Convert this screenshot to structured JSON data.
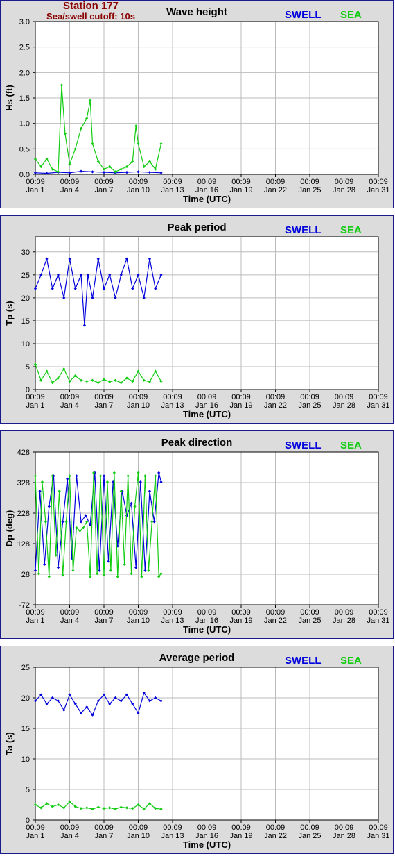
{
  "header": {
    "station": "Station 177",
    "cutoff": "Sea/swell cutoff: 10s"
  },
  "legend": {
    "swell": "SWELL",
    "sea": "SEA"
  },
  "colors": {
    "swell": "#0000dd",
    "sea": "#11cc11",
    "title": "#000000",
    "station": "#8b0000",
    "grid": "#bbbbbb",
    "panel_bg": "#dcdcdc",
    "plot_bg": "#ffffff",
    "border": "#1a1a8c"
  },
  "x_axis": {
    "label": "Time (UTC)",
    "tick_times": [
      "00:09",
      "00:09",
      "00:09",
      "00:09",
      "00:09",
      "00:09",
      "00:09",
      "00:09",
      "00:09",
      "00:09",
      "00:09"
    ],
    "tick_dates": [
      "Jan 1",
      "Jan 4",
      "Jan 7",
      "Jan 10",
      "Jan 13",
      "Jan 16",
      "Jan 19",
      "Jan 22",
      "Jan 25",
      "Jan 28",
      "Jan 31"
    ]
  },
  "chart_data": [
    {
      "type": "line",
      "title": "Wave height",
      "ylabel": "Hs (ft)",
      "ylim": [
        0,
        3
      ],
      "yticks": [
        "0.0",
        "0.5",
        "1.0",
        "1.5",
        "2.0",
        "2.5",
        "3.0"
      ],
      "xlim": [
        "Jan 1",
        "Jan 31"
      ],
      "series": [
        {
          "name": "SWELL",
          "x": [
            "Jan 1",
            "Jan 2",
            "Jan 3",
            "Jan 4",
            "Jan 5",
            "Jan 6",
            "Jan 7",
            "Jan 8",
            "Jan 9",
            "Jan 10",
            "Jan 11",
            "Jan 12"
          ],
          "values": [
            0.03,
            0.02,
            0.04,
            0.03,
            0.06,
            0.05,
            0.04,
            0.03,
            0.04,
            0.05,
            0.04,
            0.03
          ]
        },
        {
          "name": "SEA",
          "x": [
            "Jan 1",
            "Jan 1.5",
            "Jan 2",
            "Jan 2.5",
            "Jan 3",
            "Jan 3.3",
            "Jan 3.6",
            "Jan 4",
            "Jan 4.5",
            "Jan 5",
            "Jan 5.5",
            "Jan 5.8",
            "Jan 6",
            "Jan 6.5",
            "Jan 7",
            "Jan 7.5",
            "Jan 8",
            "Jan 8.5",
            "Jan 9",
            "Jan 9.5",
            "Jan 9.8",
            "Jan 10",
            "Jan 10.5",
            "Jan 11",
            "Jan 11.5",
            "Jan 12"
          ],
          "values": [
            0.3,
            0.15,
            0.3,
            0.1,
            0.05,
            1.75,
            0.8,
            0.2,
            0.5,
            0.9,
            1.1,
            1.45,
            0.6,
            0.25,
            0.1,
            0.15,
            0.05,
            0.1,
            0.15,
            0.25,
            0.95,
            0.6,
            0.15,
            0.25,
            0.1,
            0.6
          ]
        }
      ]
    },
    {
      "type": "line",
      "title": "Peak period",
      "ylabel": "Tp (s)",
      "ylim": [
        0,
        33.3
      ],
      "yticks": [
        "0",
        "5",
        "10",
        "15",
        "20",
        "25",
        "30"
      ],
      "xlim": [
        "Jan 1",
        "Jan 31"
      ],
      "series": [
        {
          "name": "SWELL",
          "x": [
            "Jan 1",
            "Jan 1.5",
            "Jan 2",
            "Jan 2.5",
            "Jan 3",
            "Jan 3.5",
            "Jan 4",
            "Jan 4.5",
            "Jan 5",
            "Jan 5.3",
            "Jan 5.6",
            "Jan 6",
            "Jan 6.5",
            "Jan 7",
            "Jan 7.5",
            "Jan 8",
            "Jan 8.5",
            "Jan 9",
            "Jan 9.5",
            "Jan 10",
            "Jan 10.5",
            "Jan 11",
            "Jan 11.5",
            "Jan 12"
          ],
          "values": [
            22,
            25,
            28.5,
            22,
            25,
            20,
            28.5,
            22,
            25,
            14,
            25,
            20,
            28.5,
            22,
            25,
            20,
            25,
            28.5,
            22,
            25,
            20,
            28.5,
            22,
            25
          ]
        },
        {
          "name": "SEA",
          "x": [
            "Jan 1",
            "Jan 1.5",
            "Jan 2",
            "Jan 2.5",
            "Jan 3",
            "Jan 3.5",
            "Jan 4",
            "Jan 4.5",
            "Jan 5",
            "Jan 5.5",
            "Jan 6",
            "Jan 6.5",
            "Jan 7",
            "Jan 7.5",
            "Jan 8",
            "Jan 8.5",
            "Jan 9",
            "Jan 9.5",
            "Jan 10",
            "Jan 10.5",
            "Jan 11",
            "Jan 11.5",
            "Jan 12"
          ],
          "values": [
            5.5,
            2,
            4,
            1.5,
            2.5,
            4.5,
            1.8,
            3,
            2,
            1.8,
            2,
            1.5,
            2.2,
            1.7,
            2,
            1.5,
            2.5,
            1.8,
            4,
            2,
            1.7,
            4,
            1.8
          ]
        }
      ]
    },
    {
      "type": "line",
      "title": "Peak direction",
      "ylabel": "Dp (deg)",
      "ylim": [
        -72,
        428
      ],
      "yticks": [
        "-72",
        "28",
        "128",
        "228",
        "328",
        "428"
      ],
      "xlim": [
        "Jan 1",
        "Jan 31"
      ],
      "series": [
        {
          "name": "SWELL",
          "x": [
            "Jan 1",
            "Jan 1.4",
            "Jan 1.8",
            "Jan 2.2",
            "Jan 2.6",
            "Jan 3",
            "Jan 3.4",
            "Jan 3.8",
            "Jan 4.2",
            "Jan 4.6",
            "Jan 5",
            "Jan 5.4",
            "Jan 5.8",
            "Jan 6.2",
            "Jan 6.6",
            "Jan 7",
            "Jan 7.4",
            "Jan 7.8",
            "Jan 8.2",
            "Jan 8.6",
            "Jan 9",
            "Jan 9.4",
            "Jan 9.8",
            "Jan 10.2",
            "Jan 10.6",
            "Jan 11",
            "Jan 11.4",
            "Jan 11.8",
            "Jan 12"
          ],
          "values": [
            40,
            300,
            60,
            250,
            350,
            50,
            200,
            340,
            80,
            350,
            200,
            220,
            190,
            360,
            40,
            350,
            70,
            330,
            120,
            300,
            220,
            260,
            50,
            330,
            40,
            300,
            200,
            360,
            330
          ]
        },
        {
          "name": "SEA",
          "x": [
            "Jan 1",
            "Jan 1.3",
            "Jan 1.6",
            "Jan 1.9",
            "Jan 2.2",
            "Jan 2.5",
            "Jan 2.8",
            "Jan 3.1",
            "Jan 3.4",
            "Jan 3.7",
            "Jan 4",
            "Jan 4.3",
            "Jan 4.6",
            "Jan 4.9",
            "Jan 5.2",
            "Jan 5.5",
            "Jan 5.8",
            "Jan 6.1",
            "Jan 6.4",
            "Jan 6.7",
            "Jan 7",
            "Jan 7.3",
            "Jan 7.6",
            "Jan 7.9",
            "Jan 8.2",
            "Jan 8.5",
            "Jan 8.8",
            "Jan 9.1",
            "Jan 9.4",
            "Jan 9.7",
            "Jan 10",
            "Jan 10.3",
            "Jan 10.6",
            "Jan 10.9",
            "Jan 11.2",
            "Jan 11.5",
            "Jan 11.8",
            "Jan 12"
          ],
          "values": [
            350,
            30,
            330,
            200,
            20,
            350,
            90,
            300,
            25,
            200,
            350,
            40,
            180,
            170,
            180,
            200,
            20,
            360,
            30,
            350,
            25,
            330,
            40,
            360,
            20,
            300,
            60,
            350,
            30,
            250,
            360,
            20,
            350,
            40,
            200,
            350,
            20,
            30
          ]
        }
      ]
    },
    {
      "type": "line",
      "title": "Average period",
      "ylabel": "Ta (s)",
      "ylim": [
        0,
        25
      ],
      "yticks": [
        "0",
        "5",
        "10",
        "15",
        "20",
        "25"
      ],
      "xlim": [
        "Jan 1",
        "Jan 31"
      ],
      "series": [
        {
          "name": "SWELL",
          "x": [
            "Jan 1",
            "Jan 1.5",
            "Jan 2",
            "Jan 2.5",
            "Jan 3",
            "Jan 3.5",
            "Jan 4",
            "Jan 4.5",
            "Jan 5",
            "Jan 5.5",
            "Jan 6",
            "Jan 6.5",
            "Jan 7",
            "Jan 7.5",
            "Jan 8",
            "Jan 8.5",
            "Jan 9",
            "Jan 9.5",
            "Jan 10",
            "Jan 10.5",
            "Jan 11",
            "Jan 11.5",
            "Jan 12"
          ],
          "values": [
            19.5,
            20.5,
            19,
            20,
            19.5,
            18,
            20.5,
            19,
            17.5,
            18.5,
            17.2,
            19.5,
            20.5,
            19,
            20,
            19.5,
            20.5,
            19,
            17.5,
            20.8,
            19.5,
            20,
            19.5
          ]
        },
        {
          "name": "SEA",
          "x": [
            "Jan 1",
            "Jan 1.5",
            "Jan 2",
            "Jan 2.5",
            "Jan 3",
            "Jan 3.5",
            "Jan 4",
            "Jan 4.5",
            "Jan 5",
            "Jan 5.5",
            "Jan 6",
            "Jan 6.5",
            "Jan 7",
            "Jan 7.5",
            "Jan 8",
            "Jan 8.5",
            "Jan 9",
            "Jan 9.5",
            "Jan 10",
            "Jan 10.5",
            "Jan 11",
            "Jan 11.5",
            "Jan 12"
          ],
          "values": [
            2.5,
            2,
            2.7,
            2.2,
            2.5,
            2,
            3,
            2.2,
            1.9,
            2,
            1.8,
            2.1,
            1.9,
            2,
            1.8,
            2.1,
            2,
            1.9,
            2.5,
            1.8,
            2.7,
            1.9,
            1.8
          ]
        }
      ]
    }
  ]
}
